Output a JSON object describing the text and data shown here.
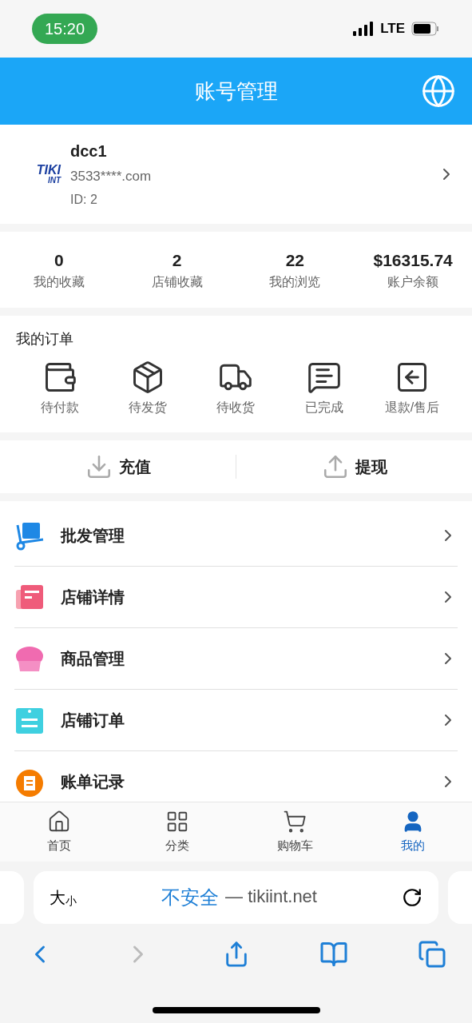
{
  "status_bar": {
    "time": "15:20",
    "network": "LTE"
  },
  "header": {
    "title": "账号管理"
  },
  "profile": {
    "name": "dcc1",
    "email": "3533****.com",
    "id": "ID: 2",
    "logo_text": "TIKI",
    "logo_sub": "INT"
  },
  "stats": [
    {
      "value": "0",
      "label": "我的收藏"
    },
    {
      "value": "2",
      "label": "店铺收藏"
    },
    {
      "value": "22",
      "label": "我的浏览"
    },
    {
      "value": "$16315.74",
      "label": "账户余额"
    }
  ],
  "orders": {
    "title": "我的订单",
    "items": [
      {
        "kind": "wallet",
        "label": "待付款"
      },
      {
        "kind": "box",
        "label": "待发货"
      },
      {
        "kind": "truck",
        "label": "待收货"
      },
      {
        "kind": "message",
        "label": "已完成"
      },
      {
        "kind": "return",
        "label": "退款/售后"
      }
    ]
  },
  "funds": [
    {
      "kind": "download",
      "label": "充值"
    },
    {
      "kind": "upload",
      "label": "提现"
    }
  ],
  "menu": [
    {
      "kind": "cart",
      "label": "批发管理",
      "color": "#1e88e5"
    },
    {
      "kind": "card",
      "label": "店铺详情",
      "color": "#ef5b7a"
    },
    {
      "kind": "cupcake",
      "label": "商品管理",
      "color": "#f06bb0"
    },
    {
      "kind": "clipboard",
      "label": "店铺订单",
      "color": "#3fd0e0"
    },
    {
      "kind": "bill",
      "label": "账单记录",
      "color": "#f57c00"
    }
  ],
  "tabs": [
    {
      "kind": "home",
      "label": "首页",
      "selected": false
    },
    {
      "kind": "grid",
      "label": "分类",
      "selected": false
    },
    {
      "kind": "cart",
      "label": "购物车",
      "selected": false
    },
    {
      "kind": "user",
      "label": "我的",
      "selected": true
    }
  ],
  "browser": {
    "text_size_big": "大",
    "text_size_small": "小",
    "security": "不安全",
    "url": "— tikiint.net"
  }
}
